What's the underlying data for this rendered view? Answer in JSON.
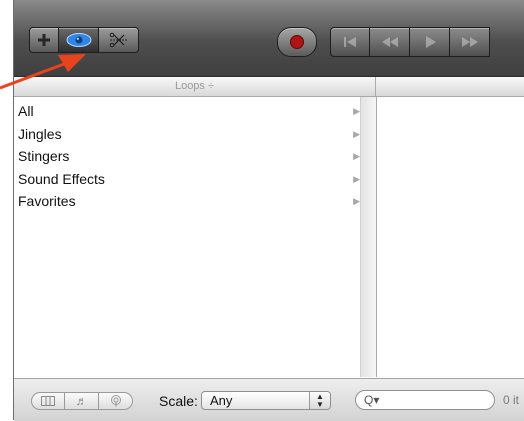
{
  "toolbar": {
    "add_icon": "plus-icon",
    "loop_browser_icon": "eye-icon",
    "editor_icon": "scissors-icon",
    "record_icon": "record-icon",
    "transport_icons": [
      "skip-to-start-icon",
      "rewind-icon",
      "play-icon",
      "fast-forward-icon"
    ]
  },
  "loops_header": {
    "label": "Loops ÷"
  },
  "loops_list": [
    {
      "label": "All"
    },
    {
      "label": "Jingles"
    },
    {
      "label": "Stingers"
    },
    {
      "label": "Sound Effects"
    },
    {
      "label": "Favorites"
    }
  ],
  "bottom": {
    "view_buttons": [
      "column-view-icon",
      "music-note-icon",
      "podcast-icon"
    ],
    "scale_label": "Scale:",
    "scale_value": "Any",
    "search_placeholder": "Q▾",
    "item_count": "0 it"
  },
  "colors": {
    "toolbar_top": "#8a8a8a",
    "toolbar_bottom": "#3f3f3f",
    "record": "#b01515",
    "eye_accent": "#2f86e8",
    "annotation_arrow": "#e8431c"
  }
}
